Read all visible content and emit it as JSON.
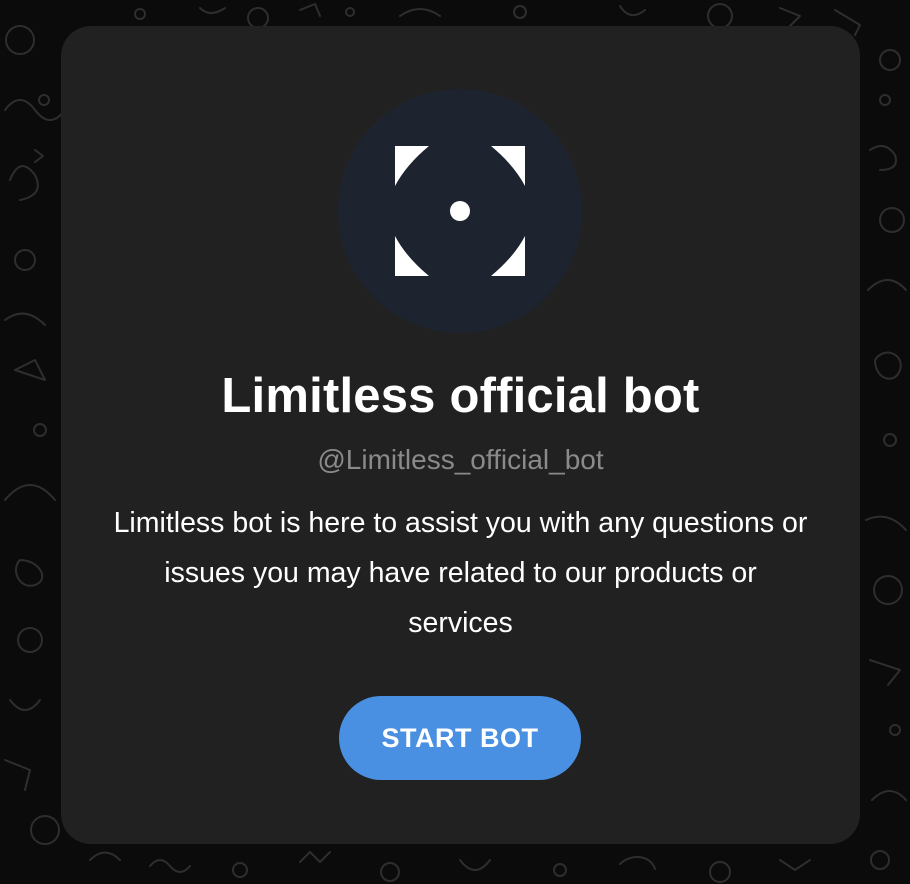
{
  "colors": {
    "background": "#0b0b0b",
    "card": "#212121",
    "avatar_bg": "#1d2430",
    "accent": "#4a90e2",
    "title_text": "#ffffff",
    "handle_text": "#8a8a8a"
  },
  "avatar": {
    "icon": "viewfinder-focus-icon"
  },
  "bot": {
    "name": "Limitless official bot",
    "username": "@Limitless_official_bot",
    "description": "Limitless bot is here to assist you with any questions or issues you may have related to our products or services"
  },
  "actions": {
    "start_label": "START BOT"
  }
}
